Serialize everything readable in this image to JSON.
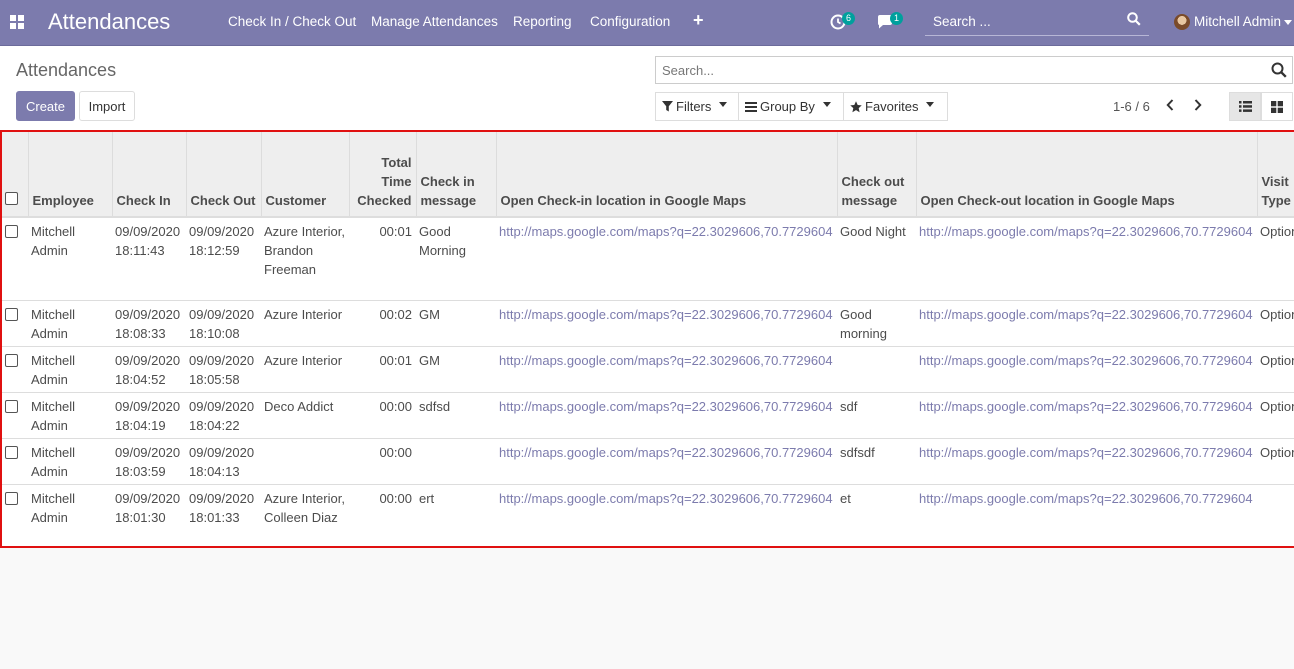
{
  "navbar": {
    "brand": "Attendances",
    "menu": [
      {
        "label": "Check In / Check Out"
      },
      {
        "label": "Manage Attendances"
      },
      {
        "label": "Reporting"
      },
      {
        "label": "Configuration"
      }
    ],
    "activity_count": "6",
    "messages_count": "1",
    "search_placeholder": "Search ...",
    "user": "Mitchell Admin",
    "accent_color": "#7c7bad",
    "badge_color": "#00a09d"
  },
  "control_panel": {
    "breadcrumb": "Attendances",
    "create_label": "Create",
    "import_label": "Import",
    "search_placeholder": "Search...",
    "filters_label": "Filters",
    "groupby_label": "Group By",
    "favorites_label": "Favorites",
    "pager": "1-6 / 6"
  },
  "table": {
    "headers": {
      "employee": "Employee",
      "check_in": "Check In",
      "check_out": "Check Out",
      "customer": "Customer",
      "total_time": "Total Time Checked",
      "check_in_msg": "Check in message",
      "check_in_loc": "Open Check-in location in Google Maps",
      "check_out_msg": "Check out message",
      "check_out_loc": "Open Check-out location in Google Maps",
      "visit_type": "Visit Type"
    },
    "rows": [
      {
        "employee": "Mitchell Admin",
        "check_in": "09/09/2020 18:11:43",
        "check_out": "09/09/2020 18:12:59",
        "customer": "Azure Interior, Brandon Freeman",
        "total": "00:01",
        "in_msg": "Good Morning",
        "in_loc": "http://maps.google.com/maps?q=22.3029606,70.7729604",
        "out_msg": "Good Night",
        "out_loc": "http://maps.google.com/maps?q=22.3029606,70.7729604",
        "visit_type": "Optional"
      },
      {
        "employee": "Mitchell Admin",
        "check_in": "09/09/2020 18:08:33",
        "check_out": "09/09/2020 18:10:08",
        "customer": "Azure Interior",
        "total": "00:02",
        "in_msg": "GM",
        "in_loc": "http://maps.google.com/maps?q=22.3029606,70.7729604",
        "out_msg": "Good morning",
        "out_loc": "http://maps.google.com/maps?q=22.3029606,70.7729604",
        "visit_type": "Optional"
      },
      {
        "employee": "Mitchell Admin",
        "check_in": "09/09/2020 18:04:52",
        "check_out": "09/09/2020 18:05:58",
        "customer": "Azure Interior",
        "total": "00:01",
        "in_msg": "GM",
        "in_loc": "http://maps.google.com/maps?q=22.3029606,70.7729604",
        "out_msg": "",
        "out_loc": "http://maps.google.com/maps?q=22.3029606,70.7729604",
        "visit_type": "Optional"
      },
      {
        "employee": "Mitchell Admin",
        "check_in": "09/09/2020 18:04:19",
        "check_out": "09/09/2020 18:04:22",
        "customer": "Deco Addict",
        "total": "00:00",
        "in_msg": "sdfsd",
        "in_loc": "http://maps.google.com/maps?q=22.3029606,70.7729604",
        "out_msg": "sdf",
        "out_loc": "http://maps.google.com/maps?q=22.3029606,70.7729604",
        "visit_type": "Optional"
      },
      {
        "employee": "Mitchell Admin",
        "check_in": "09/09/2020 18:03:59",
        "check_out": "09/09/2020 18:04:13",
        "customer": "",
        "total": "00:00",
        "in_msg": "",
        "in_loc": "http://maps.google.com/maps?q=22.3029606,70.7729604",
        "out_msg": "sdfsdf",
        "out_loc": "http://maps.google.com/maps?q=22.3029606,70.7729604",
        "visit_type": "Optional"
      },
      {
        "employee": "Mitchell Admin",
        "check_in": "09/09/2020 18:01:30",
        "check_out": "09/09/2020 18:01:33",
        "customer": "Azure Interior, Colleen Diaz",
        "total": "00:00",
        "in_msg": "ert",
        "in_loc": "http://maps.google.com/maps?q=22.3029606,70.7729604",
        "out_msg": "et",
        "out_loc": "http://maps.google.com/maps?q=22.3029606,70.7729604",
        "visit_type": ""
      }
    ]
  }
}
